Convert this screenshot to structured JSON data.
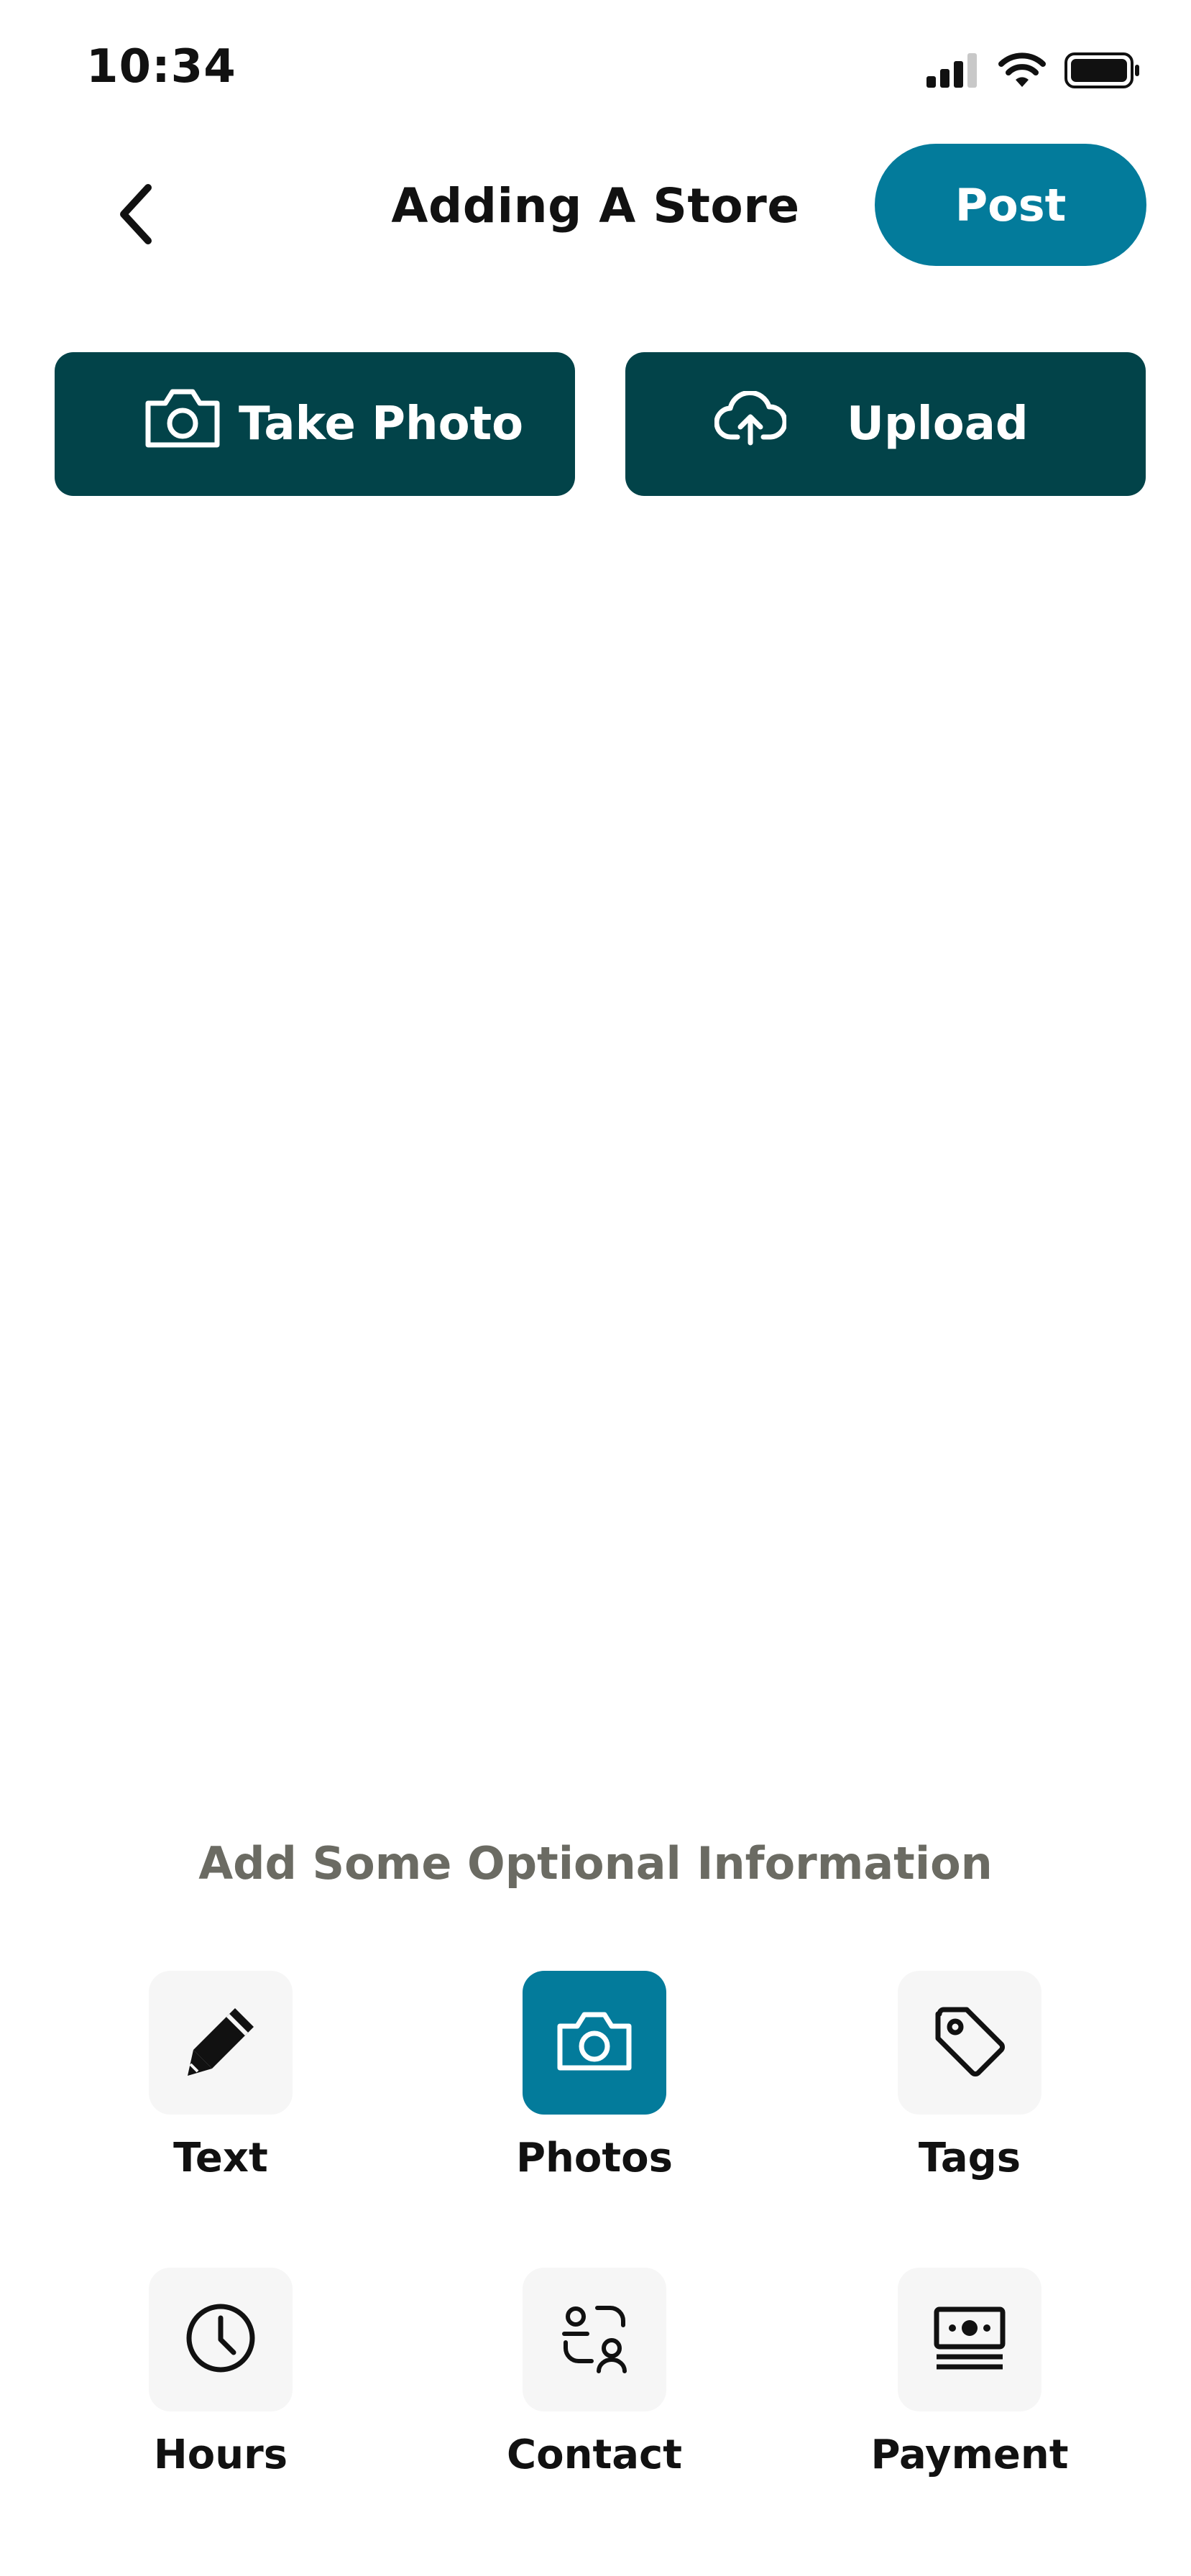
{
  "status_bar": {
    "time": "10:34"
  },
  "header": {
    "title": "Adding A Store",
    "post_label": "Post"
  },
  "actions": {
    "take_photo_label": "Take Photo",
    "upload_label": "Upload"
  },
  "optional_section": {
    "heading": "Add Some Optional Information",
    "items": [
      {
        "label": "Text",
        "icon": "pencil-icon",
        "selected": false
      },
      {
        "label": "Photos",
        "icon": "camera-icon",
        "selected": true
      },
      {
        "label": "Tags",
        "icon": "tag-icon",
        "selected": false
      },
      {
        "label": "Hours",
        "icon": "clock-icon",
        "selected": false
      },
      {
        "label": "Contact",
        "icon": "contact-icon",
        "selected": false
      },
      {
        "label": "Payment",
        "icon": "payment-icon",
        "selected": false
      }
    ]
  },
  "colors": {
    "accent": "#037b9b",
    "dark": "#024349",
    "tile_bg": "#f6f6f6",
    "heading_gray": "#6b6b63"
  }
}
